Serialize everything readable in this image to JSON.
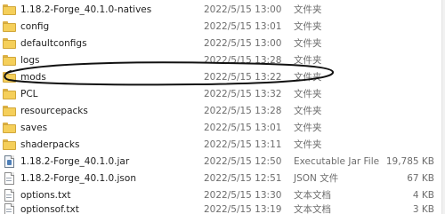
{
  "files": [
    {
      "name": "1.18.2-Forge_40.1.0-natives",
      "date": "2022/5/15 13:00",
      "type": "文件夹",
      "size": "",
      "icon": "folder-icon"
    },
    {
      "name": "config",
      "date": "2022/5/15 13:01",
      "type": "文件夹",
      "size": "",
      "icon": "folder-icon"
    },
    {
      "name": "defaultconfigs",
      "date": "2022/5/15 13:00",
      "type": "文件夹",
      "size": "",
      "icon": "folder-icon"
    },
    {
      "name": "logs",
      "date": "2022/5/15 13:28",
      "type": "文件夹",
      "size": "",
      "icon": "folder-icon"
    },
    {
      "name": "mods",
      "date": "2022/5/15 13:22",
      "type": "文件夹",
      "size": "",
      "icon": "folder-icon"
    },
    {
      "name": "PCL",
      "date": "2022/5/15 13:32",
      "type": "文件夹",
      "size": "",
      "icon": "folder-icon"
    },
    {
      "name": "resourcepacks",
      "date": "2022/5/15 13:28",
      "type": "文件夹",
      "size": "",
      "icon": "folder-icon"
    },
    {
      "name": "saves",
      "date": "2022/5/15 13:01",
      "type": "文件夹",
      "size": "",
      "icon": "folder-icon"
    },
    {
      "name": "shaderpacks",
      "date": "2022/5/15 13:11",
      "type": "文件夹",
      "size": "",
      "icon": "folder-icon"
    },
    {
      "name": "1.18.2-Forge_40.1.0.jar",
      "date": "2022/5/15 12:50",
      "type": "Executable Jar File",
      "size": "19,785 KB",
      "icon": "jar-file-icon"
    },
    {
      "name": "1.18.2-Forge_40.1.0.json",
      "date": "2022/5/15 12:51",
      "type": "JSON 文件",
      "size": "67 KB",
      "icon": "json-file-icon"
    },
    {
      "name": "options.txt",
      "date": "2022/5/15 13:30",
      "type": "文本文档",
      "size": "4 KB",
      "icon": "text-file-icon"
    },
    {
      "name": "optionsof.txt",
      "date": "2022/5/15 13:19",
      "type": "文本文档",
      "size": "3 KB",
      "icon": "text-file-icon"
    }
  ],
  "annotation": {
    "color": "#111111",
    "target": "mods"
  }
}
